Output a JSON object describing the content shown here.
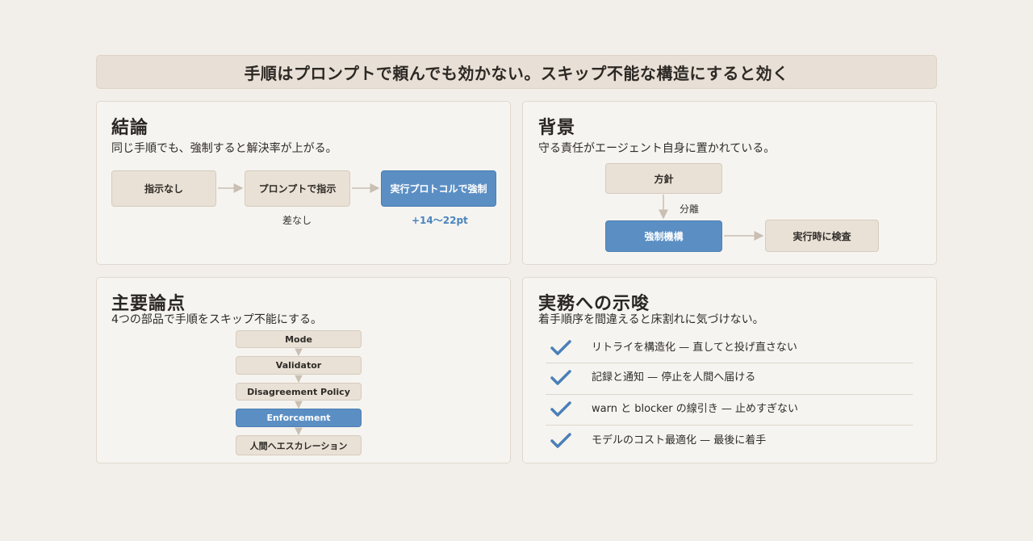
{
  "title": "手順はプロンプトで頼んでも効かない。スキップ不能な構造にすると効く",
  "conclusion": {
    "title": "結論",
    "subtitle": "同じ手順でも、強制すると解決率が上がる。",
    "flow": [
      "指示なし",
      "プロンプトで指示",
      "実行プロトコルで強制"
    ],
    "note_middle": "差なし",
    "note_right": "+14〜22pt"
  },
  "background": {
    "title": "背景",
    "subtitle": "守る責任がエージェント自身に置かれている。",
    "policy": "方針",
    "separation": "分離",
    "mechanism": "強制機構",
    "runtime_check": "実行時に検査"
  },
  "key_points": {
    "title": "主要論点",
    "subtitle": "4つの部品で手順をスキップ不能にする。",
    "stack": [
      "Mode",
      "Validator",
      "Disagreement Policy",
      "Enforcement",
      "人間へエスカレーション"
    ]
  },
  "implications": {
    "title": "実務への示唆",
    "subtitle": "着手順序を間違えると床割れに気づけない。",
    "items": [
      "リトライを構造化 — 直してと投げ直さない",
      "記録と通知 — 停止を人間へ届ける",
      "warn と blocker の線引き — 止めすぎない",
      "モデルのコスト最適化 — 最後に着手"
    ]
  },
  "colors": {
    "accent_blue": "#5b8fc4",
    "beige_box": "#e9e1d6",
    "check_blue": "#4a7fb8"
  }
}
